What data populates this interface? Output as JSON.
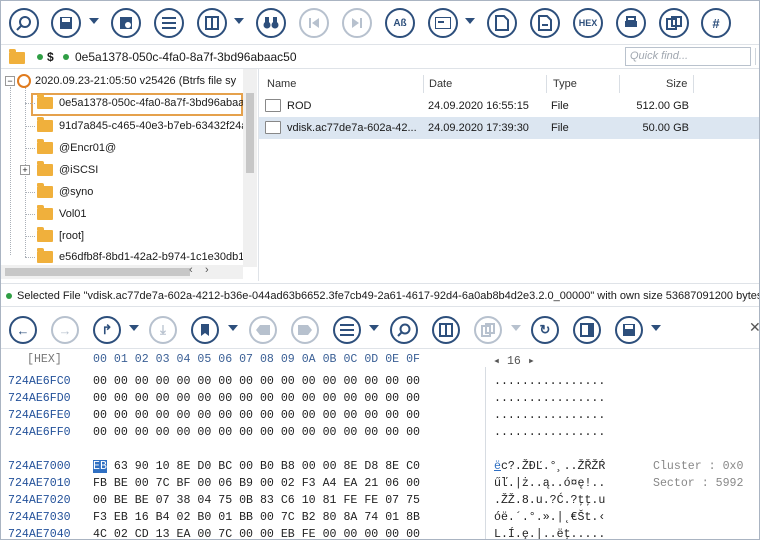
{
  "path_bar": {
    "symbol": "$",
    "path": "0e5a1378-050c-4fa0-8a7f-3bd96abaac50",
    "search_placeholder": "Quick find..."
  },
  "tree": {
    "root": "2020.09.23-21:05:50 v25426 (Btrfs file sy",
    "items": [
      "0e5a1378-050c-4fa0-8a7f-3bd96abaa",
      "91d7a845-c465-40e3-b7eb-63432f24a",
      "@Encr01@",
      "@iSCSI",
      "@syno",
      "Vol01",
      "[root]",
      "e56dfb8f-8bd1-42a2-b974-1c1e30db1"
    ]
  },
  "files": {
    "columns": [
      "Name",
      "Date",
      "Type",
      "Size"
    ],
    "rows": [
      {
        "name": "ROD",
        "date": "24.09.2020 16:55:15",
        "type": "File",
        "size": "512.00 GB"
      },
      {
        "name": "vdisk.ac77de7a-602a-42...",
        "date": "24.09.2020 17:39:30",
        "type": "File",
        "size": "50.00 GB"
      }
    ]
  },
  "status_text": "Selected File \"vdisk.ac77de7a-602a-4212-b36e-044ad63b6652.3fe7cb49-2a61-4617-92d4-6a0ab8b4d2e3.2.0_00000\" with own size 53687091200 bytes.",
  "hex": {
    "header_label": "[HEX]",
    "header_bytes": "00 01 02 03 04 05 06 07 08 09 0A 0B 0C 0D 0E 0F",
    "page": "16",
    "rows_top": [
      {
        "addr": "724AE6FC0",
        "bytes": "00 00 00 00 00 00 00 00 00 00 00 00 00 00 00 00",
        "ascii": "................"
      },
      {
        "addr": "724AE6FD0",
        "bytes": "00 00 00 00 00 00 00 00 00 00 00 00 00 00 00 00",
        "ascii": "................"
      },
      {
        "addr": "724AE6FE0",
        "bytes": "00 00 00 00 00 00 00 00 00 00 00 00 00 00 00 00",
        "ascii": "................"
      },
      {
        "addr": "724AE6FF0",
        "bytes": "00 00 00 00 00 00 00 00 00 00 00 00 00 00 00 00",
        "ascii": "................"
      }
    ],
    "first_byte": "EB",
    "rows_bottom": [
      {
        "addr": "724AE7000",
        "bytes": "63 90 10 8E D0 BC 00 B0 B8 00 00 8E D8 8E C0",
        "ascii_first": "ë",
        "ascii": "c?.ŽĐĽ.°¸..ŽŘŽŔ"
      },
      {
        "addr": "724AE7010",
        "bytes": "FB BE 00 7C BF 00 06 B9 00 02 F3 A4 EA 21 06 00",
        "ascii": "űľ.|ż..ą..ó¤ę!.."
      },
      {
        "addr": "724AE7020",
        "bytes": "00 BE BE 07 38 04 75 0B 83 C6 10 81 FE FE 07 75",
        "ascii": ".ŽŽ.8.u.?Ć.?ţţ.u"
      },
      {
        "addr": "724AE7030",
        "bytes": "F3 EB 16 B4 02 B0 01 BB 00 7C B2 80 8A 74 01 8B",
        "ascii": "óë.´.°.».|˛€Št.‹"
      },
      {
        "addr": "724AE7040",
        "bytes": "4C 02 CD 13 EA 00 7C 00 00 EB FE 00 00 00 00 00",
        "ascii": "L.Í.ę.|..ëţ....."
      }
    ],
    "cluster_label": "Cluster : 0x0",
    "sector_label": "Sector : 5992"
  }
}
